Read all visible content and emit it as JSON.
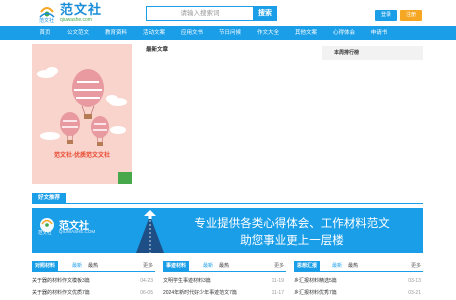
{
  "header": {
    "logo_text": "范文社",
    "logo_domain": "qiuwashe.com",
    "logo_sub": "范文社",
    "search_placeholder": "请输入搜索词",
    "search_button": "搜索",
    "login": "登录",
    "register": "注册"
  },
  "nav": {
    "items": [
      "首页",
      "公文范文",
      "教育资料",
      "活动文案",
      "应用文书",
      "节日问候",
      "作文大全",
      "其他文案",
      "心得体会",
      "申请书"
    ]
  },
  "main": {
    "banner_caption": "范文社-优质范文文社",
    "latest_title": "最新文章",
    "rank_title": "本周排行榜"
  },
  "good": {
    "title": "好文推荐"
  },
  "promo": {
    "logo_text": "范文社",
    "logo_domain": "QIUWASHE.COM",
    "logo_sub": "范文社",
    "line1": "专业提供各类心得体会、工作材料范文",
    "line2": "助您事业更上一层楼"
  },
  "columns": [
    {
      "tag": "对照材料",
      "tab1": "最新",
      "tab2": "最热",
      "more": "更多",
      "rows": [
        {
          "text": "关于器的材料作文模板3篇",
          "date": "04-23"
        },
        {
          "text": "关于器的材料作文优质7篇",
          "date": "06-05"
        }
      ]
    },
    {
      "tag": "事迹材料",
      "tab1": "最新",
      "tab2": "最热",
      "more": "更多",
      "rows": [
        {
          "text": "文明学生事迹材料3篇",
          "date": "11-19"
        },
        {
          "text": "2024年新时代好少年事迹范文7篇",
          "date": "11-17"
        }
      ]
    },
    {
      "tag": "思想汇报",
      "tab1": "最新",
      "tab2": "最热",
      "more": "更多",
      "rows": [
        {
          "text": "乡汇报材料精选5篇",
          "date": "03-13"
        },
        {
          "text": "乡汇报材料优秀7篇",
          "date": "03-21"
        }
      ]
    }
  ],
  "colors": {
    "primary": "#1a9ee8",
    "orange": "#f5a623",
    "banner_bg": "#f8d4cc"
  }
}
